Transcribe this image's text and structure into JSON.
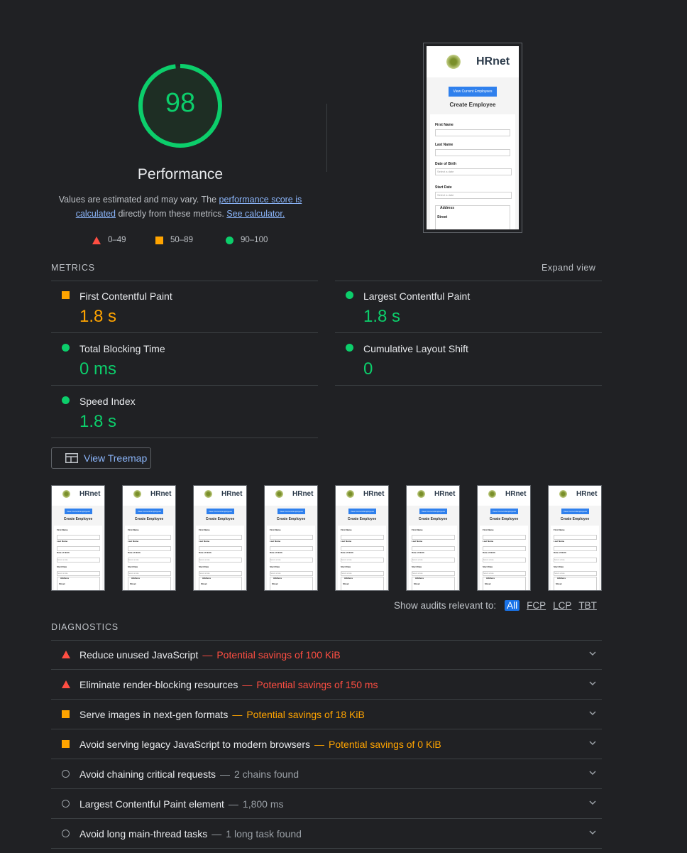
{
  "score": {
    "value": "98",
    "title": "Performance",
    "color": "#0cce6b",
    "fraction": 0.98
  },
  "description": {
    "part1": "Values are estimated and may vary. The ",
    "link1": "performance score is calculated",
    "part2": " directly from these metrics. ",
    "link2": "See calculator."
  },
  "legend": {
    "fail": "0–49",
    "average": "50–89",
    "pass": "90–100"
  },
  "page_preview": {
    "brand": "HRnet",
    "button": "View Current Employees",
    "title": "Create Employee",
    "fields": [
      "First Name",
      "Last Name",
      "Date of Birth",
      "Start Date",
      "Address",
      "Street"
    ],
    "date_placeholder": "Select a date"
  },
  "metrics": {
    "label": "METRICS",
    "expand": "Expand view",
    "items": [
      {
        "name": "First Contentful Paint",
        "value": "1.8 s",
        "status": "average"
      },
      {
        "name": "Largest Contentful Paint",
        "value": "1.8 s",
        "status": "pass"
      },
      {
        "name": "Total Blocking Time",
        "value": "0 ms",
        "status": "pass"
      },
      {
        "name": "Cumulative Layout Shift",
        "value": "0",
        "status": "pass"
      },
      {
        "name": "Speed Index",
        "value": "1.8 s",
        "status": "pass"
      }
    ]
  },
  "treemap": {
    "label": "View Treemap"
  },
  "filter": {
    "label": "Show audits relevant to:",
    "chips": [
      "All",
      "FCP",
      "LCP",
      "TBT"
    ],
    "active": "All"
  },
  "diagnostics": {
    "label": "DIAGNOSTICS",
    "items": [
      {
        "title": "Reduce unused JavaScript",
        "detail": "Potential savings of 100 KiB",
        "status": "fail"
      },
      {
        "title": "Eliminate render-blocking resources",
        "detail": "Potential savings of 150 ms",
        "status": "fail"
      },
      {
        "title": "Serve images in next-gen formats",
        "detail": "Potential savings of 18 KiB",
        "status": "average"
      },
      {
        "title": "Avoid serving legacy JavaScript to modern browsers",
        "detail": "Potential savings of 0 KiB",
        "status": "average"
      },
      {
        "title": "Avoid chaining critical requests",
        "detail": "2 chains found",
        "status": "info"
      },
      {
        "title": "Largest Contentful Paint element",
        "detail": "1,800 ms",
        "status": "info"
      },
      {
        "title": "Avoid long main-thread tasks",
        "detail": "1 long task found",
        "status": "info"
      }
    ]
  }
}
